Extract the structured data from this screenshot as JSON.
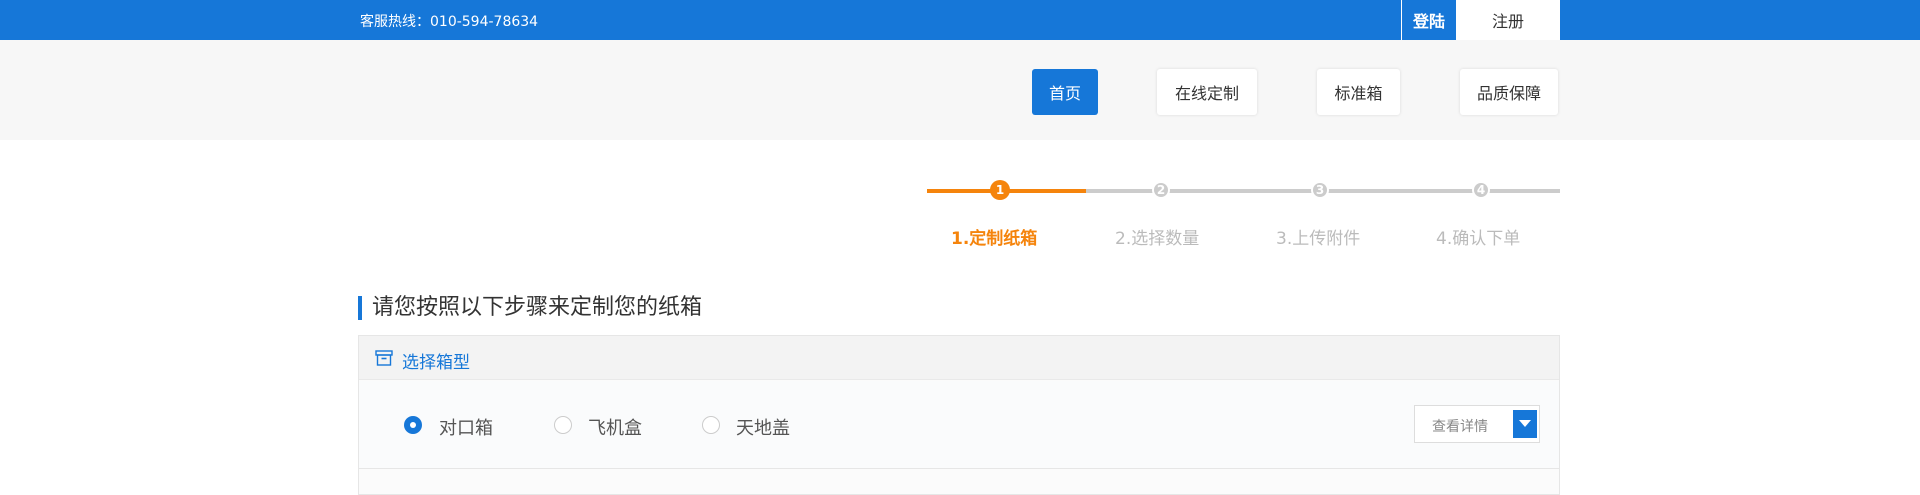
{
  "header": {
    "hotline": "客服热线：010-594-78634",
    "login_label": "登陆",
    "register_label": "注册"
  },
  "nav": {
    "items": [
      {
        "label": "首页",
        "active": true
      },
      {
        "label": "在线定制",
        "active": false
      },
      {
        "label": "标准箱",
        "active": false
      },
      {
        "label": "品质保障",
        "active": false
      }
    ]
  },
  "stepper": {
    "current": 1,
    "steps": [
      {
        "number": "1",
        "label": "1.定制纸箱"
      },
      {
        "number": "2",
        "label": "2.选择数量"
      },
      {
        "number": "3",
        "label": "3.上传附件"
      },
      {
        "number": "4",
        "label": "4.确认下单"
      }
    ]
  },
  "section": {
    "title": "请您按照以下步骤来定制您的纸箱"
  },
  "panel": {
    "head_label": "选择箱型",
    "options": [
      {
        "label": "对口箱",
        "checked": true
      },
      {
        "label": "飞机盒",
        "checked": false
      },
      {
        "label": "天地盖",
        "checked": false
      }
    ],
    "detail_label": "查看详情"
  },
  "colors": {
    "brand_blue": "#1677d8",
    "step_orange": "#f5840c",
    "step_inactive": "#cccccc"
  }
}
